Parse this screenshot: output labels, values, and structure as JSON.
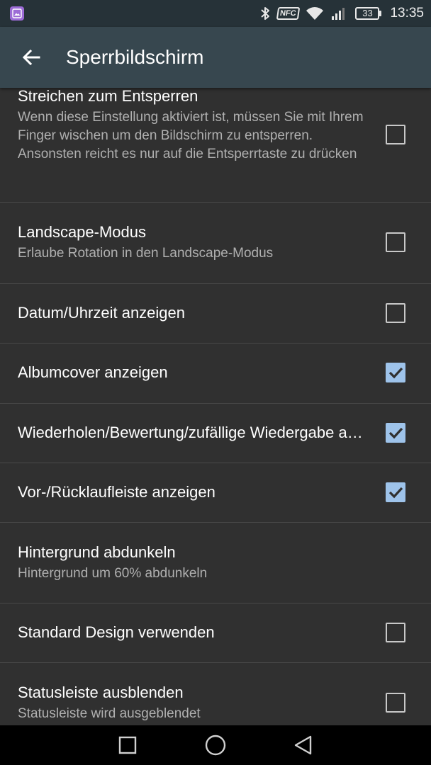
{
  "status_bar": {
    "time": "13:35",
    "battery": "33",
    "nfc_label": "NFC",
    "icons": [
      "gallery-notification-icon",
      "bluetooth-icon",
      "nfc-icon",
      "wifi-icon",
      "signal-icon",
      "battery-icon"
    ]
  },
  "app_bar": {
    "title": "Sperrbildschirm",
    "back_icon": "arrow-back-icon"
  },
  "preferences": [
    {
      "title": "Streichen zum Entsperren",
      "summary": "Wenn diese Einstellung aktiviert ist, müssen Sie mit Ihrem Finger wischen um den Bildschirm zu entsperren. Ansonsten reicht es nur auf die Entsperrtaste zu drücken",
      "checkbox": true,
      "checked": false
    },
    {
      "title": "Landscape-Modus",
      "summary": "Erlaube Rotation in den Landscape-Modus",
      "checkbox": true,
      "checked": false
    },
    {
      "title": "Datum/Uhrzeit anzeigen",
      "checkbox": true,
      "checked": false
    },
    {
      "title": "Albumcover anzeigen",
      "checkbox": true,
      "checked": true
    },
    {
      "title": "Wiederholen/Bewertung/zufällige Wiedergabe anzeigen",
      "checkbox": true,
      "checked": true
    },
    {
      "title": "Vor-/Rücklaufleiste anzeigen",
      "checkbox": true,
      "checked": true
    },
    {
      "title": "Hintergrund abdunkeln",
      "summary": "Hintergrund um 60% abdunkeln",
      "checkbox": false
    },
    {
      "title": "Standard Design verwenden",
      "checkbox": true,
      "checked": false
    },
    {
      "title": "Statusleiste ausblenden",
      "summary": "Statusleiste wird ausgeblendet",
      "checkbox": true,
      "checked": false
    }
  ],
  "colors": {
    "status_bar": "#263238",
    "app_bar": "#37474f",
    "background": "#303030",
    "divider": "#484848",
    "checkbox_checked": "#9ec3ea",
    "summary_text": "#b0b0b0"
  },
  "nav_bar": {
    "buttons": [
      "recents-square-icon",
      "home-circle-icon",
      "back-triangle-icon"
    ]
  }
}
